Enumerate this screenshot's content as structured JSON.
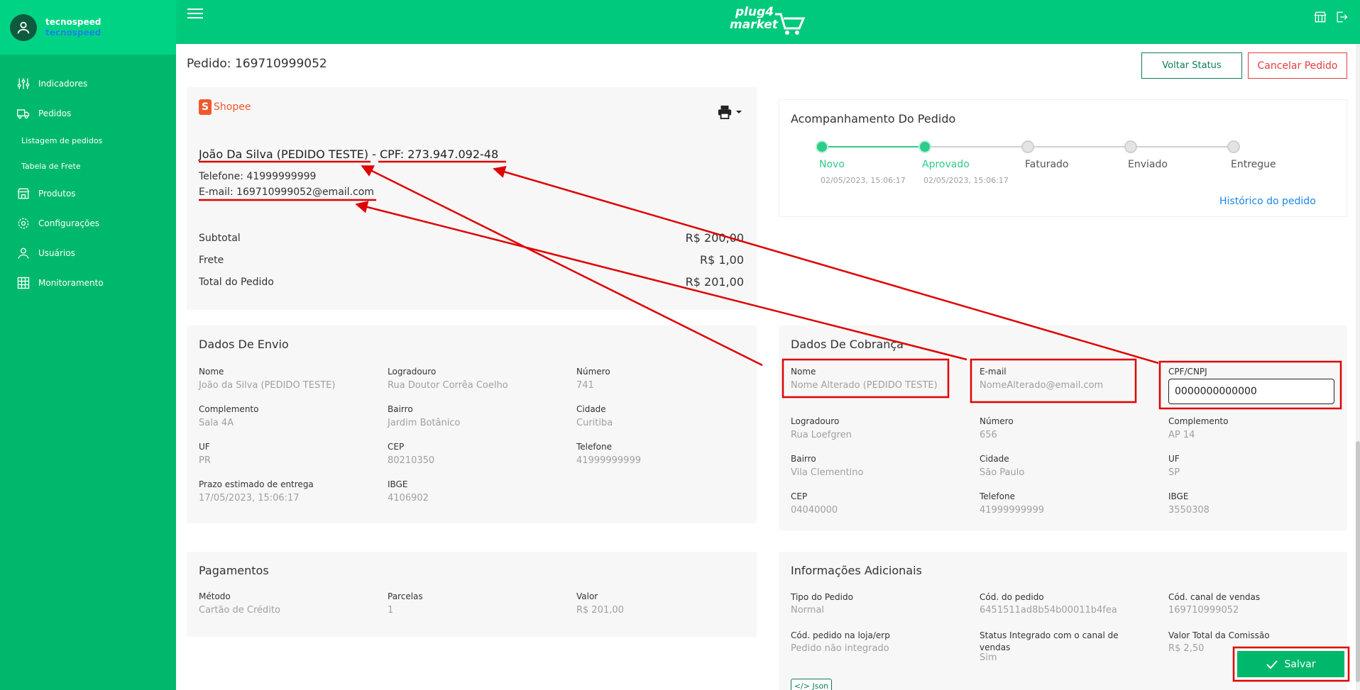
{
  "sidebar": {
    "user_name": "tecnospeed",
    "user_company": "tecnospeed",
    "items": [
      {
        "label": "Indicadores"
      },
      {
        "label": "Pedidos"
      },
      {
        "label": "Listagem de pedidos"
      },
      {
        "label": "Tabela de Frete"
      },
      {
        "label": "Produtos"
      },
      {
        "label": "Configurações"
      },
      {
        "label": "Usuários"
      },
      {
        "label": "Monitoramento"
      }
    ]
  },
  "header": {
    "logo_line1": "plug4",
    "logo_line2": "market"
  },
  "page": {
    "title": "Pedido: 169710999052",
    "btn_voltar": "Voltar Status",
    "btn_cancelar": "Cancelar Pedido"
  },
  "order": {
    "marketplace": "Shopee",
    "customer_line": "João Da Silva (PEDIDO TESTE) - CPF: 273.947.092-48",
    "phone": "Telefone: 41999999999",
    "email": "E-mail: 169710999052@email.com",
    "subtotal_label": "Subtotal",
    "subtotal_value": "R$ 200,00",
    "frete_label": "Frete",
    "frete_value": "R$ 1,00",
    "total_label": "Total do Pedido",
    "total_value": "R$ 201,00"
  },
  "tracking": {
    "title": "Acompanhamento Do Pedido",
    "steps": [
      {
        "label": "Novo",
        "date": "02/05/2023, 15:06:17"
      },
      {
        "label": "Aprovado",
        "date": "02/05/2023, 15:06:17"
      },
      {
        "label": "Faturado",
        "date": ""
      },
      {
        "label": "Enviado",
        "date": ""
      },
      {
        "label": "Entregue",
        "date": ""
      }
    ],
    "history_link": "Histórico do pedido",
    "colors": {
      "active": "#2ecc8a",
      "inactive": "#d0d0d0"
    }
  },
  "shipping": {
    "title": "Dados De Envio",
    "fields": [
      {
        "label": "Nome",
        "value": "João da Silva (PEDIDO TESTE)"
      },
      {
        "label": "Logradouro",
        "value": "Rua Doutor Corrêa Coelho"
      },
      {
        "label": "Número",
        "value": "741"
      },
      {
        "label": "Complemento",
        "value": "Sala 4A"
      },
      {
        "label": "Bairro",
        "value": "Jardim Botânico"
      },
      {
        "label": "Cidade",
        "value": "Curitiba"
      },
      {
        "label": "UF",
        "value": "PR"
      },
      {
        "label": "CEP",
        "value": "80210350"
      },
      {
        "label": "Telefone",
        "value": "41999999999"
      },
      {
        "label": "Prazo estimado de entrega",
        "value": "17/05/2023, 15:06:17"
      },
      {
        "label": "IBGE",
        "value": "4106902"
      }
    ]
  },
  "billing": {
    "title": "Dados De Cobrança",
    "nome_label": "Nome",
    "nome_value": "Nome Alterado (PEDIDO TESTE)",
    "email_label": "E-mail",
    "email_value": "NomeAlterado@email.com",
    "cpf_label": "CPF/CNPJ",
    "cpf_value": "0000000000000",
    "fields": [
      {
        "label": "Logradouro",
        "value": "Rua Loefgren"
      },
      {
        "label": "Número",
        "value": "656"
      },
      {
        "label": "Complemento",
        "value": "AP 14"
      },
      {
        "label": "Bairro",
        "value": "Vila Clementino"
      },
      {
        "label": "Cidade",
        "value": "São Paulo"
      },
      {
        "label": "UF",
        "value": "SP"
      },
      {
        "label": "CEP",
        "value": "04040000"
      },
      {
        "label": "Telefone",
        "value": "41999999999"
      },
      {
        "label": "IBGE",
        "value": "3550308"
      }
    ]
  },
  "payments": {
    "title": "Pagamentos",
    "fields": [
      {
        "label": "Método",
        "value": "Cartão de Crédito"
      },
      {
        "label": "Parcelas",
        "value": "1"
      },
      {
        "label": "Valor",
        "value": "R$ 201,00"
      }
    ]
  },
  "additional": {
    "title": "Informações Adicionais",
    "fields": [
      {
        "label": "Tipo do Pedido",
        "value": "Normal"
      },
      {
        "label": "Cód. do pedido",
        "value": "6451511ad8b54b00011b4fea"
      },
      {
        "label": "Cód. canal de vendas",
        "value": "169710999052"
      },
      {
        "label": "Cód. pedido na loja/erp",
        "value": "Pedido não integrado"
      },
      {
        "label": "Status Integrado com o canal de vendas",
        "value": "Sim"
      },
      {
        "label": "Valor Total da Comissão",
        "value": "R$ 2,50"
      }
    ],
    "json_button": "Json",
    "save_button": "Salvar"
  },
  "colors": {
    "brand_green": "#00c97b",
    "sidebar_green": "#00b86b",
    "annotation_red": "#e00000"
  }
}
